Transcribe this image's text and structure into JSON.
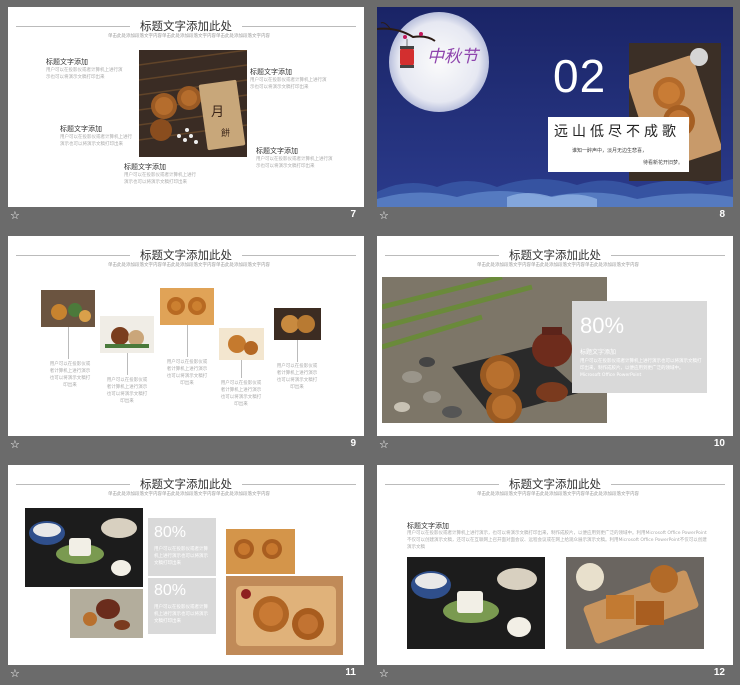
{
  "slides": [
    {
      "num": "7",
      "title": "标题文字添加此处",
      "subtitle": "单击此处添加段落文字内容单击此处添加段落文字内容单击此处添加段落文字内容",
      "blocks": [
        {
          "h": "标题文字添加",
          "p": "用户可以在投影仪或者计算机上进行演示也可以将演示文稿打印出来"
        },
        {
          "h": "标题文字添加",
          "p": "用户可以在投影仪或者计算机上进行演示也可以将演示文稿打印出来"
        },
        {
          "h": "标题文字添加",
          "p": "用户可以在投影仪或者计算机上进行演示也可以将演示文稿打印出来"
        },
        {
          "h": "标题文字添加",
          "p": "用户可以在投影仪或者计算机上进行演示也可以将演示文稿打印出来"
        },
        {
          "h": "标题文字添加",
          "p": "用户可以在投影仪或者计算机上进行演示也可以将演示文稿打印出来"
        }
      ]
    },
    {
      "num": "8",
      "big": "02",
      "banner": "远山低尽不成歌",
      "line1": "谁知一醉声中，淡月无边生悲喜，",
      "line2": "待看新花开旧梦。",
      "logo": "中秋节"
    },
    {
      "num": "9",
      "title": "标题文字添加此处",
      "subtitle": "单击此处添加段落文字内容单击此处添加段落文字内容单击此处添加段落文字内容",
      "captions": [
        "用户可以在投影仪或者计算机上进行演示也可以将演示文稿打印出来",
        "用户可以在投影仪或者计算机上进行演示也可以将演示文稿打印出来",
        "用户可以在投影仪或者计算机上进行演示也可以将演示文稿打印出来",
        "用户可以在投影仪或者计算机上进行演示也可以将演示文稿打印出来",
        "用户可以在投影仪或者计算机上进行演示也可以将演示文稿打印出来"
      ]
    },
    {
      "num": "10",
      "title": "标题文字添加此处",
      "subtitle": "单击此处添加段落文字内容单击此处添加段落文字内容单击此处添加段落文字内容",
      "pct": "80%",
      "h": "标题文字添加",
      "p": "用户可以在投影仪或者计算机上进行演示也可以将演示文稿打印出来，制作成胶片，以便应用到更广泛的领域中。Microsoft Office PowerPoint"
    },
    {
      "num": "11",
      "title": "标题文字添加此处",
      "subtitle": "单击此处添加段落文字内容单击此处添加段落文字内容单击此处添加段落文字内容",
      "pct1": "80%",
      "p1": "用户可以在投影仪或者计算机上进行演示也可以将演示文稿打印出来",
      "pct2": "80%",
      "p2": "用户可以在投影仪或者计算机上进行演示也可以将演示文稿打印出来"
    },
    {
      "num": "12",
      "title": "标题文字添加此处",
      "subtitle": "单击此处添加段落文字内容单击此处添加段落文字内容单击此处添加段落文字内容",
      "h": "标题文字添加",
      "p": "用户可以在投影仪或者计算机上进行演示，也可以将演示文稿打印出来，制作成胶片，以便应用到更广泛的领域中。利用Microsoft Office PowerPoint不仅可以创建演示文稿，还可以在互联网上召开面对面会议、远程会议或在网上给观众展示演示文稿。利用Microsoft Office PowerPoint不仅可以创建演示文稿"
    }
  ],
  "colors": {
    "bar": "#6b6b6b",
    "navy": "#1d2a6e",
    "grey": "#d9d9d9"
  }
}
